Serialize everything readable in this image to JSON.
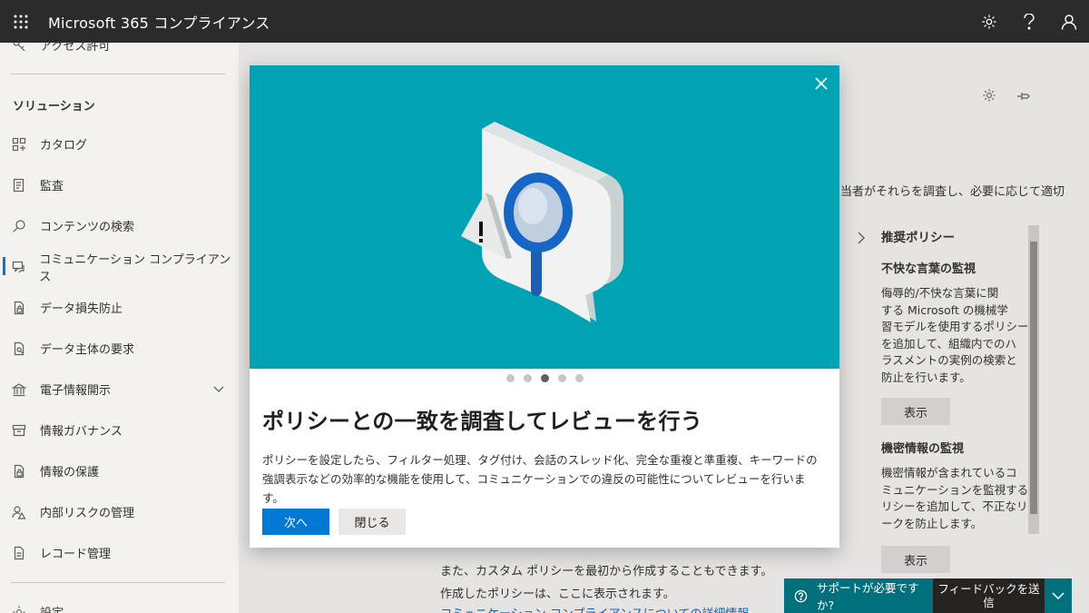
{
  "app": {
    "title": "Microsoft 365 コンプライアンス"
  },
  "topbar_icons": [
    "settings-icon",
    "help-icon",
    "account-icon"
  ],
  "nav": {
    "partial_top": "アクセス許可",
    "section_label": "ソリューション",
    "items": [
      {
        "label": "カタログ",
        "icon": "catalog-icon"
      },
      {
        "label": "監査",
        "icon": "audit-icon"
      },
      {
        "label": "コンテンツの検索",
        "icon": "search-icon"
      },
      {
        "label": "コミュニケーション コンプライアンス",
        "icon": "communication-icon",
        "active": true
      },
      {
        "label": "データ損失防止",
        "icon": "dlp-icon"
      },
      {
        "label": "データ主体の要求",
        "icon": "dsr-icon"
      },
      {
        "label": "電子情報開示",
        "icon": "ediscovery-icon",
        "expandable": true
      },
      {
        "label": "情報ガバナンス",
        "icon": "governance-icon"
      },
      {
        "label": "情報の保護",
        "icon": "protection-icon"
      },
      {
        "label": "内部リスクの管理",
        "icon": "insider-risk-icon"
      },
      {
        "label": "レコード管理",
        "icon": "records-icon"
      }
    ],
    "partial_bottom": "設定"
  },
  "background": {
    "partial_right": "当者がそれらを調査し、必要に応じて適切",
    "line1": "また、カスタム ポリシーを最初から作成することもできます。",
    "line2": "作成したポリシーは、ここに表示されます。",
    "link": "コミュニケーション コンプライアンスについての詳細情報"
  },
  "side_panel": {
    "title": "推奨ポリシー",
    "cards": [
      {
        "title": "不快な言葉の監視",
        "lines": [
          "侮辱的/不快な言葉に関",
          "する Microsoft の機械学",
          "習モデルを使用するポリシー",
          "を追加して、組織内でのハ",
          "ラスメントの実例の検索と",
          "防止を行います。"
        ],
        "button": "表示"
      },
      {
        "title": "機密情報の監視",
        "lines": [
          "機密情報が含まれているコ",
          "ミュニケーションを監視するポ",
          "リシーを追加して、不正なリ",
          "ークを防止します。"
        ],
        "button": "表示"
      }
    ]
  },
  "modal": {
    "title": "ポリシーとの一致を調査してレビューを行う",
    "body": "ポリシーを設定したら、フィルター処理、タグ付け、会話のスレッド化、完全な重複と準重複、キーワードの強調表示などの効率的な機能を使用して、コミュニケーションでの違反の可能性についてレビューを行います。",
    "primary": "次へ",
    "secondary": "閉じる",
    "steps_total": 5,
    "step_current": 3
  },
  "support": {
    "label": "サポートが必要ですか?"
  },
  "feedback": {
    "label": "フィードバックを送信"
  },
  "colors": {
    "hero": "#00a3b3",
    "primary": "#0078d4",
    "topbar": "#2b2b2b",
    "support": "#02707c"
  }
}
